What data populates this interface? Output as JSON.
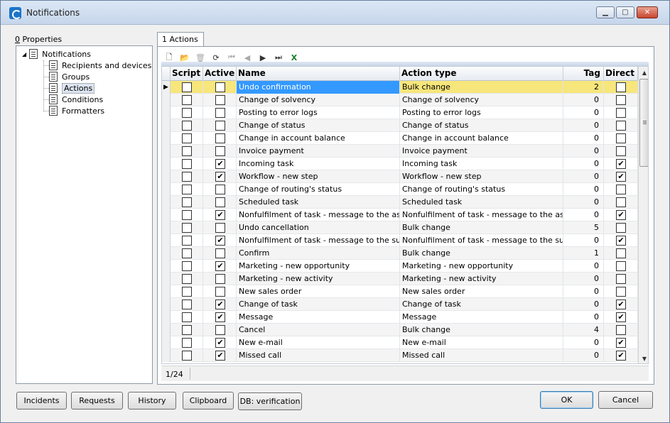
{
  "window": {
    "title": "Notifications",
    "controls": {
      "minimize": "▁",
      "maximize": "▢",
      "close": "✕"
    }
  },
  "left_panel": {
    "label_prefix": "0",
    "label_rest": " Properties",
    "tree": {
      "root": "Notifications",
      "children": [
        "Recipients and devices",
        "Groups",
        "Actions",
        "Conditions",
        "Formatters"
      ],
      "selected_index": 2
    }
  },
  "tab": {
    "label": "1 Actions"
  },
  "toolbar": {
    "icons": [
      {
        "name": "new-icon",
        "glyph": "🗋",
        "enabled": true
      },
      {
        "name": "open-icon",
        "glyph": "📂",
        "enabled": true
      },
      {
        "name": "delete-icon",
        "glyph": "🗑",
        "enabled": false
      },
      {
        "name": "refresh-icon",
        "glyph": "⟳",
        "enabled": true
      },
      {
        "name": "first-record-icon",
        "glyph": "⏮",
        "enabled": false
      },
      {
        "name": "previous-record-icon",
        "glyph": "◀",
        "enabled": false
      },
      {
        "name": "next-record-icon",
        "glyph": "▶",
        "enabled": true
      },
      {
        "name": "last-record-icon",
        "glyph": "⏭",
        "enabled": true
      },
      {
        "name": "excel-export-icon",
        "glyph": "X",
        "enabled": true
      }
    ]
  },
  "grid": {
    "columns": [
      "Script",
      "Active",
      "Name",
      "Action type",
      "Tag",
      "Direct"
    ],
    "rows": [
      {
        "script": false,
        "active": false,
        "name": "Undo confirmation",
        "action_type": "Bulk change",
        "tag": "2",
        "direct": false
      },
      {
        "script": false,
        "active": false,
        "name": "Change of solvency",
        "action_type": "Change of solvency",
        "tag": "0",
        "direct": false
      },
      {
        "script": false,
        "active": false,
        "name": "Posting to error logs",
        "action_type": "Posting to error logs",
        "tag": "0",
        "direct": false
      },
      {
        "script": false,
        "active": false,
        "name": "Change of status",
        "action_type": "Change of status",
        "tag": "0",
        "direct": false
      },
      {
        "script": false,
        "active": false,
        "name": "Change in account balance",
        "action_type": "Change in account balance",
        "tag": "0",
        "direct": false
      },
      {
        "script": false,
        "active": false,
        "name": "Invoice payment",
        "action_type": "Invoice payment",
        "tag": "0",
        "direct": false
      },
      {
        "script": false,
        "active": true,
        "name": "Incoming task",
        "action_type": "Incoming task",
        "tag": "0",
        "direct": true
      },
      {
        "script": false,
        "active": true,
        "name": "Workflow - new step",
        "action_type": "Workflow - new step",
        "tag": "0",
        "direct": true
      },
      {
        "script": false,
        "active": false,
        "name": "Change of routing's status",
        "action_type": "Change of routing's status",
        "tag": "0",
        "direct": false
      },
      {
        "script": false,
        "active": false,
        "name": "Scheduled task",
        "action_type": "Scheduled task",
        "tag": "0",
        "direct": false
      },
      {
        "script": false,
        "active": true,
        "name": "Nonfulfilment of task - message to the assignee",
        "action_type": "Nonfulfilment of task - message to the assignee",
        "tag": "0",
        "direct": true
      },
      {
        "script": false,
        "active": false,
        "name": "Undo cancellation",
        "action_type": "Bulk change",
        "tag": "5",
        "direct": false
      },
      {
        "script": false,
        "active": true,
        "name": "Nonfulfilment of task - message to the submitter",
        "action_type": "Nonfulfilment of task - message to the submitter",
        "tag": "0",
        "direct": true
      },
      {
        "script": false,
        "active": false,
        "name": "Confirm",
        "action_type": "Bulk change",
        "tag": "1",
        "direct": false
      },
      {
        "script": false,
        "active": true,
        "name": "Marketing - new opportunity",
        "action_type": "Marketing - new opportunity",
        "tag": "0",
        "direct": false
      },
      {
        "script": false,
        "active": false,
        "name": "Marketing - new activity",
        "action_type": "Marketing - new activity",
        "tag": "0",
        "direct": false
      },
      {
        "script": false,
        "active": false,
        "name": "New sales order",
        "action_type": "New sales order",
        "tag": "0",
        "direct": false
      },
      {
        "script": false,
        "active": true,
        "name": "Change of task",
        "action_type": "Change of task",
        "tag": "0",
        "direct": true
      },
      {
        "script": false,
        "active": true,
        "name": "Message",
        "action_type": "Message",
        "tag": "0",
        "direct": true
      },
      {
        "script": false,
        "active": false,
        "name": "Cancel",
        "action_type": "Bulk change",
        "tag": "4",
        "direct": false
      },
      {
        "script": false,
        "active": true,
        "name": "New e-mail",
        "action_type": "New e-mail",
        "tag": "0",
        "direct": true
      },
      {
        "script": false,
        "active": true,
        "name": "Missed call",
        "action_type": "Missed call",
        "tag": "0",
        "direct": true
      }
    ],
    "selected_row": 0,
    "status": "1/24"
  },
  "footer": {
    "left_buttons": [
      "Incidents",
      "Requests",
      "History",
      "Clipboard",
      "DB: verification"
    ],
    "ok": "OK",
    "cancel": "Cancel"
  },
  "colors": {
    "selected_row": "#f7e67b",
    "selected_cell": "#3399ff"
  }
}
